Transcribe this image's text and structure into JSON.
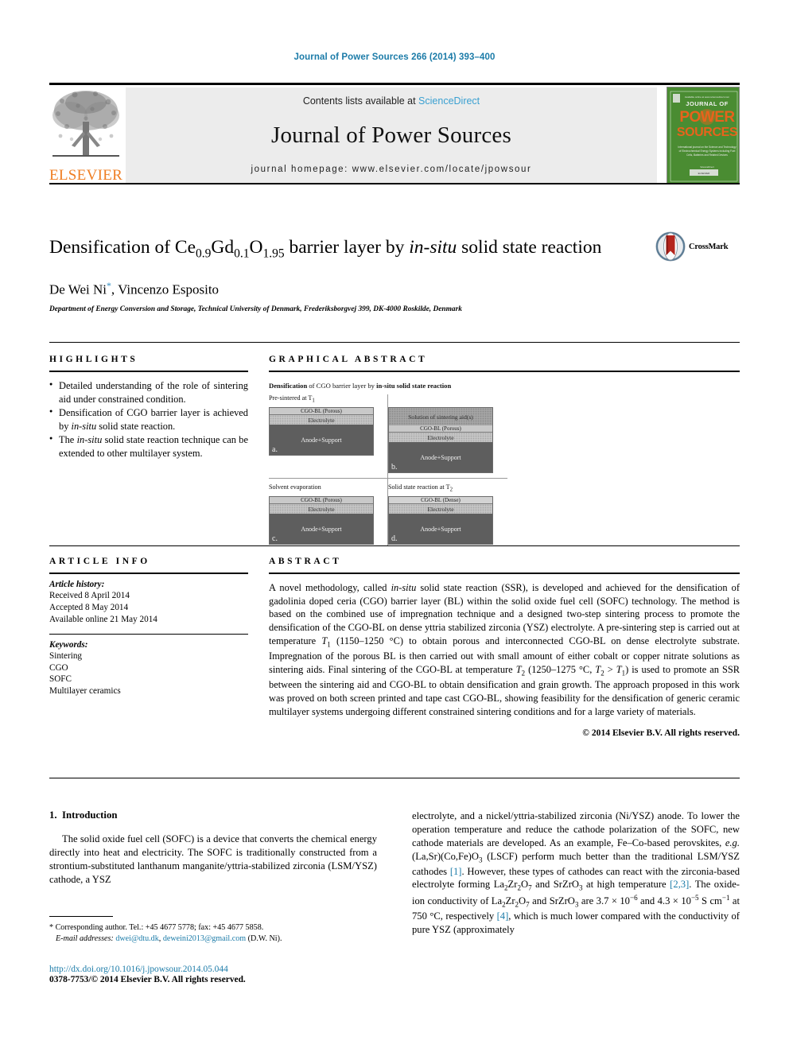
{
  "running_head": "Journal of Power Sources 266 (2014) 393–400",
  "masthead": {
    "contents_prefix": "Contents lists available at ",
    "sciencedirect": "ScienceDirect",
    "journal_name": "Journal of Power Sources",
    "homepage": "journal homepage: www.elsevier.com/locate/jpowsour",
    "publisher_wordmark": "ELSEVIER",
    "cover": {
      "line1": "JOURNAL OF",
      "line2": "POWER",
      "line3": "SOURCES",
      "blurb": "International journal on the Science and Technology of Electrochemical Energy Systems including Fuel Cells, Batteries and Related Devices",
      "footer": "Available online at www.sciencedirect.com"
    }
  },
  "colors": {
    "link": "#1b7ba8",
    "sciencedirect": "#3aa0d1",
    "elsevier_orange": "#ef7d22",
    "cover_green": "#4a8c32",
    "cover_orange": "#e8631c",
    "crossmark_ribbon": "#b4251d"
  },
  "article": {
    "title_part1": "Densification of Ce",
    "title_sub1": "0.9",
    "title_part2": "Gd",
    "title_sub2": "0.1",
    "title_part3": "O",
    "title_sub3": "1.95",
    "title_part4": " barrier layer by ",
    "title_italic": "in-situ",
    "title_part5": " solid state reaction",
    "authors": "De Wei Ni, Vincenzo Esposito",
    "author_marker": "*",
    "affiliation": "Department of Energy Conversion and Storage, Technical University of Denmark, Frederiksborgvej 399, DK-4000 Roskilde, Denmark",
    "crossmark_label": "CrossMark"
  },
  "highlights": {
    "heading": "HIGHLIGHTS",
    "items": [
      {
        "pre": "Detailed understanding of the role of sintering aid under constrained condition.",
        "italic": "",
        "post": ""
      },
      {
        "pre": "Densification of CGO barrier layer is achieved by ",
        "italic": "in-situ",
        "post": " solid state reaction."
      },
      {
        "pre": "The ",
        "italic": "in-situ",
        "post": " solid state reaction technique can be extended to other multilayer system."
      }
    ]
  },
  "graphical_abstract": {
    "heading": "GRAPHICAL ABSTRACT",
    "figure_title_bold": "Densification",
    "figure_title_rest": " of CGO barrier layer by ",
    "figure_title_bold2": "in-situ solid state reaction",
    "panels": [
      {
        "letter": "a.",
        "caption_pre": "Pre-sintered at T",
        "caption_sub": "1",
        "solution_label": "",
        "cgo_label": "CGO-BL (Porous)",
        "electrolyte_label": "Electrolyte",
        "anode_label": "Anode+Support"
      },
      {
        "letter": "b.",
        "caption_pre": "",
        "caption_sub": "",
        "solution_label": "Solution of sintering aid(s)",
        "cgo_label": "CGO-BL (Porous)",
        "electrolyte_label": "Electrolyte",
        "anode_label": "Anode+Support"
      },
      {
        "letter": "c.",
        "caption_pre": "Solvent evaporation",
        "caption_sub": "",
        "solution_label": "",
        "cgo_label": "CGO-BL (Porous)",
        "electrolyte_label": "Electrolyte",
        "anode_label": "Anode+Support"
      },
      {
        "letter": "d.",
        "caption_pre": "Solid state reaction at T",
        "caption_sub": "2",
        "solution_label": "",
        "cgo_label": "CGO-BL (Dense)",
        "electrolyte_label": "Electrolyte",
        "anode_label": "Anode+Support"
      }
    ]
  },
  "article_info": {
    "heading": "ARTICLE INFO",
    "history_title": "Article history:",
    "history": [
      "Received 8 April 2014",
      "Accepted 8 May 2014",
      "Available online 21 May 2014"
    ],
    "keywords_title": "Keywords:",
    "keywords": [
      "Sintering",
      "CGO",
      "SOFC",
      "Multilayer ceramics"
    ]
  },
  "abstract": {
    "heading": "ABSTRACT",
    "copyright": "© 2014 Elsevier B.V. All rights reserved."
  },
  "introduction": {
    "section_number": "1.",
    "section_title": "Introduction"
  },
  "footnote": {
    "marker": "*",
    "corresponding": "Corresponding author. Tel.: +45 4677 5778; fax: +45 4677 5858.",
    "email_label": "E-mail addresses:",
    "email1": "dwei@dtu.dk",
    "email2": "deweini2013@gmail.com",
    "email_suffix": "(D.W. Ni).",
    "doi": "http://dx.doi.org/10.1016/j.jpowsour.2014.05.044",
    "issn": "0378-7753/© 2014 Elsevier B.V. All rights reserved."
  }
}
